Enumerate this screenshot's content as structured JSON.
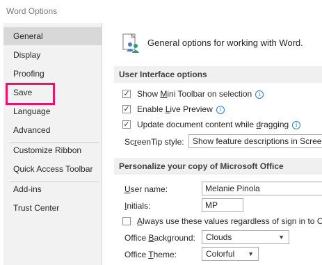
{
  "window": {
    "title": "Word Options"
  },
  "sidebar": {
    "items": [
      {
        "label": "General",
        "selected": true
      },
      {
        "label": "Display"
      },
      {
        "label": "Proofing"
      },
      {
        "label": "Save",
        "highlighted": true
      },
      {
        "label": "Language"
      },
      {
        "label": "Advanced"
      },
      {
        "label": "Customize Ribbon"
      },
      {
        "label": "Quick Access Toolbar"
      },
      {
        "label": "Add-ins"
      },
      {
        "label": "Trust Center"
      }
    ]
  },
  "content": {
    "header": "General options for working with Word.",
    "ui_section": {
      "title": "User Interface options",
      "options": [
        {
          "pre": "Show ",
          "u": "M",
          "post": "ini Toolbar on selection",
          "checked": true
        },
        {
          "pre": "Enable ",
          "u": "L",
          "post": "ive Preview",
          "checked": true
        },
        {
          "pre": "Update document content while ",
          "u": "d",
          "post": "ragging",
          "checked": true
        }
      ],
      "screentip": {
        "pre": "Sc",
        "u": "r",
        "post": "eenTip style:",
        "value": "Show feature descriptions in ScreenTips"
      }
    },
    "personalize_section": {
      "title": "Personalize your copy of Microsoft Office",
      "username": {
        "u": "U",
        "post": "ser name:",
        "value": "Melanie Pinola"
      },
      "initials": {
        "u": "I",
        "post": "nitials:",
        "value": "MP"
      },
      "always_use": {
        "u": "A",
        "post": "lways use these values regardless of sign in to Office.",
        "checked": false
      },
      "background": {
        "pre": "Office ",
        "u": "B",
        "post": "ackground:",
        "value": "Clouds"
      },
      "theme": {
        "pre": "Office ",
        "u": "T",
        "post": "heme:",
        "value": "Colorful"
      }
    }
  },
  "colors": {
    "highlight": "#e8136b",
    "info_icon": "#2b79d0",
    "sidebar_bg": "#f2f2f2",
    "selected_bg": "#d8d8d8"
  },
  "icons": {
    "header_icon": "people-settings-icon",
    "check": "✓",
    "info": "i",
    "dropdown": "▼"
  }
}
